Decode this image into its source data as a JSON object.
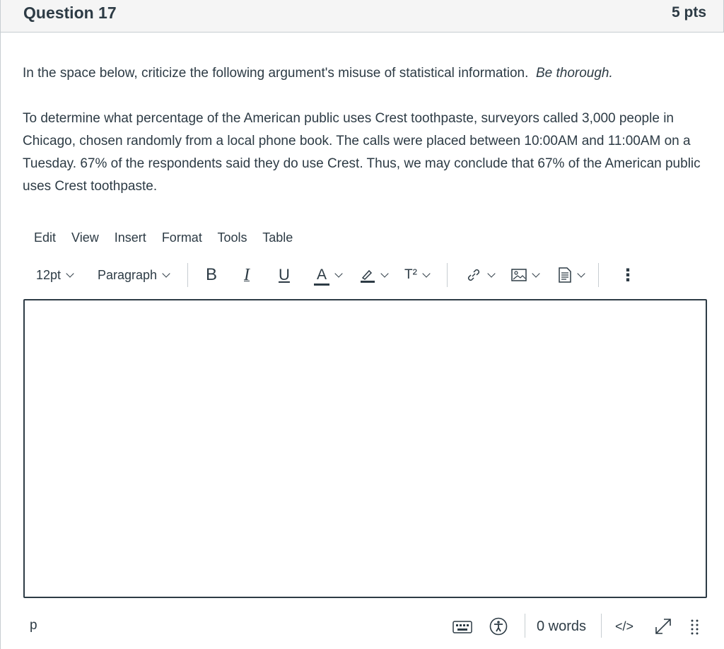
{
  "question": {
    "title": "Question 17",
    "points": "5 pts",
    "prompt_plain": "In the space below, criticize the following argument's misuse of statistical information.",
    "prompt_italic": "Be thorough.",
    "argument": "To determine what percentage of the American public uses Crest toothpaste, surveyors called 3,000 people in Chicago, chosen randomly from a local phone book.  The calls were placed between 10:00AM and 11:00AM on a Tuesday.  67% of the respondents said they do use Crest.  Thus, we may conclude that 67% of the American public uses Crest toothpaste."
  },
  "editor": {
    "menu": [
      "Edit",
      "View",
      "Insert",
      "Format",
      "Tools",
      "Table"
    ],
    "font_size": "12pt",
    "block_format": "Paragraph",
    "bold_label": "B",
    "italic_label": "I",
    "underline_label": "U",
    "text_color_label": "A",
    "superscript_label": "T²",
    "more_label": "⋮",
    "element_path": "p",
    "word_count": "0 words",
    "html_toggle": "</>"
  },
  "icons": {
    "link": "link-icon",
    "image": "image-icon",
    "document": "document-icon",
    "keyboard": "keyboard-icon",
    "accessibility": "accessibility-icon",
    "fullscreen": "fullscreen-icon",
    "resize": "resize-handle-icon"
  }
}
